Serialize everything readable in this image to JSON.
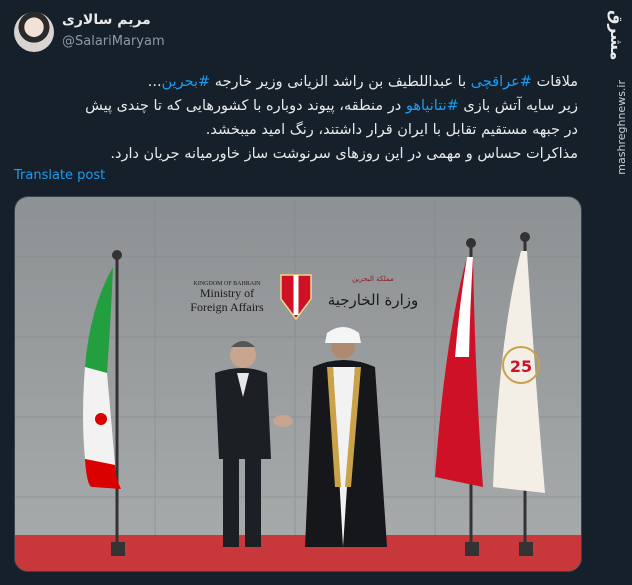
{
  "tweet": {
    "author_name": "مریم سالاری",
    "author_handle": "@SalariMaryam",
    "lines": [
      {
        "parts": [
          {
            "text": "ملاقات "
          },
          {
            "text": "#عراقچی",
            "tag": true
          },
          {
            "text": " با عبداللطیف بن راشد الزیانی وزیر خارجه "
          },
          {
            "text": "#بحرین",
            "tag": true
          },
          {
            "text": "..."
          }
        ]
      },
      {
        "parts": [
          {
            "text": "زیر سایه آتش بازی "
          },
          {
            "text": "#نتانیاهو",
            "tag": true
          },
          {
            "text": " در منطقه، پیوند دوباره با کشورهایی که تا چندی پیش"
          }
        ]
      },
      {
        "parts": [
          {
            "text": "در جبهه مستقیم تقابل با ایران قرار داشتند، رنگ امید میبخشد."
          }
        ]
      },
      {
        "parts": [
          {
            "text": "مذاکرات حساس و مهمی در این روزهای سرنوشت ساز خاورمیانه جریان دارد."
          }
        ]
      }
    ],
    "translate_label": "Translate post"
  },
  "photo": {
    "sign_en_small": "KINGDOM OF BAHRAIN",
    "sign_en_1": "Ministry of",
    "sign_en_2": "Foreign Affairs",
    "sign_ar": "وزارة الخارجية",
    "sign_ar_small": "مملكة البحرين",
    "anniversary": "25"
  },
  "watermark": {
    "logo": "مشرق",
    "url": "mashreghnews.ir"
  },
  "colors": {
    "background": "#15202b",
    "accent": "#1d9bf0",
    "text": "#e7e9ea",
    "muted": "#8b98a5"
  }
}
